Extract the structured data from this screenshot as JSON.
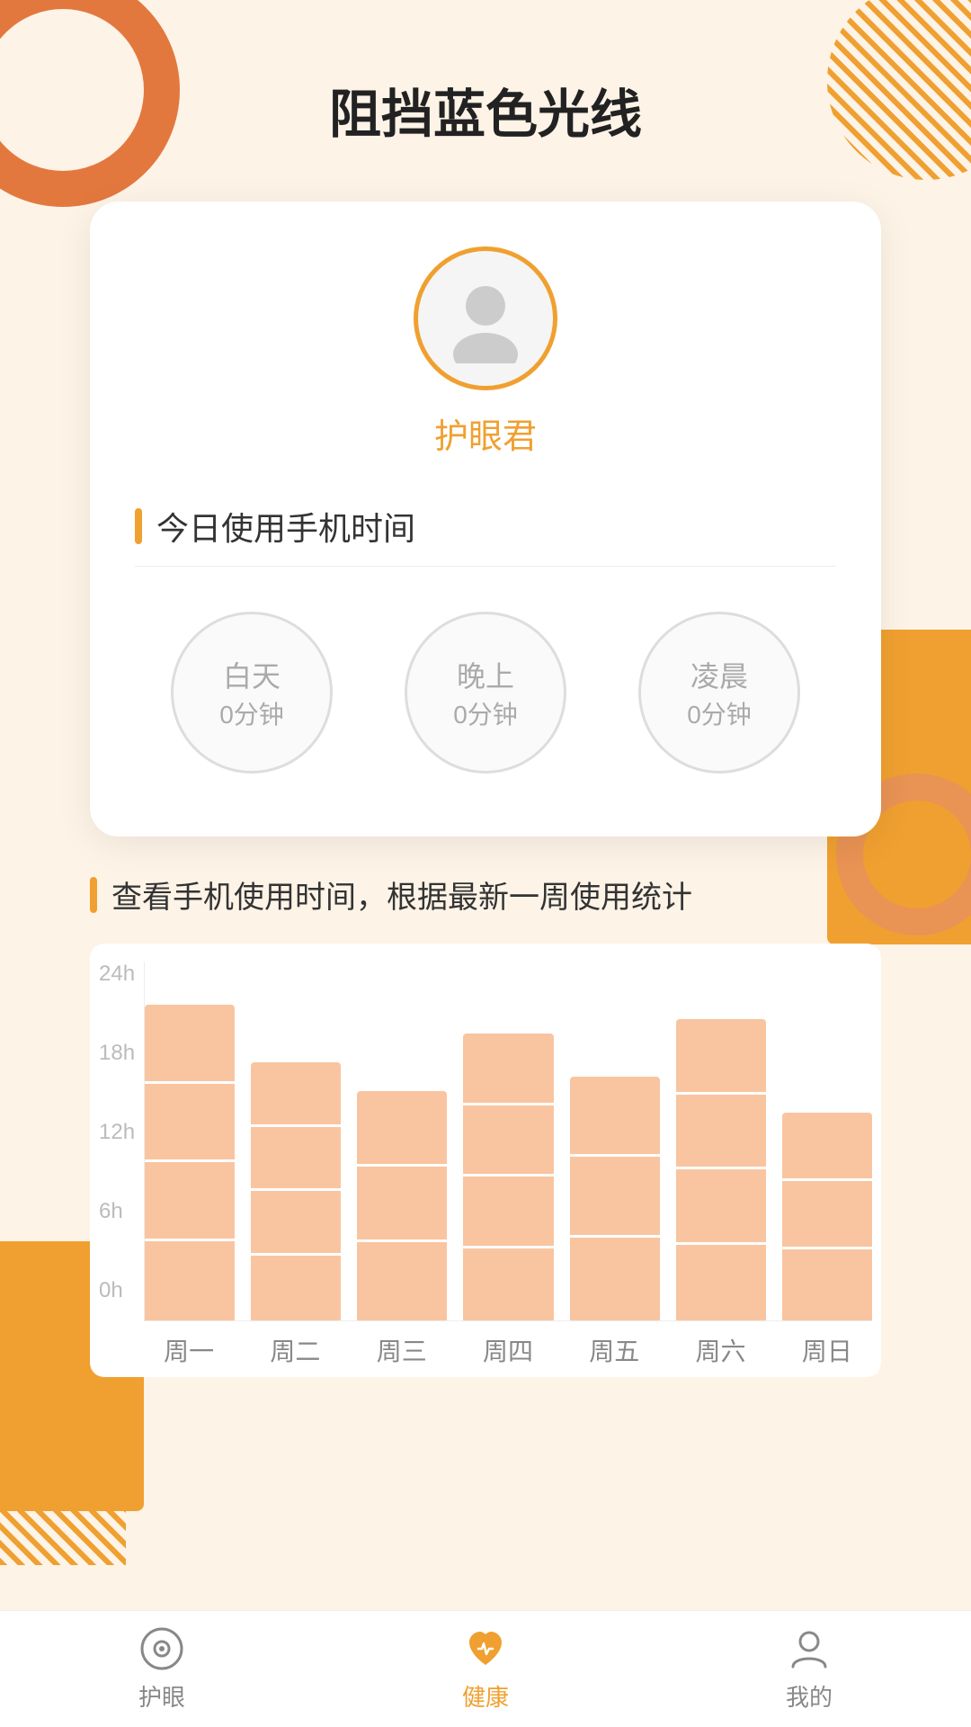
{
  "page": {
    "title": "阻挡蓝色光线",
    "background_color": "#fdf3e7"
  },
  "profile": {
    "username": "护眼君"
  },
  "usage_section": {
    "title": "今日使用手机时间",
    "daytime": {
      "label": "白天",
      "value": "0分钟"
    },
    "evening": {
      "label": "晚上",
      "value": "0分钟"
    },
    "midnight": {
      "label": "凌晨",
      "value": "0分钟"
    }
  },
  "stats_section": {
    "title": "查看手机使用时间，根据最新一周使用统计",
    "y_labels": [
      "24h",
      "18h",
      "12h",
      "6h",
      "0h"
    ],
    "x_labels": [
      "周一",
      "周二",
      "周三",
      "周四",
      "周五",
      "周六",
      "周日"
    ],
    "bars": [
      {
        "day": "周一",
        "height_pct": 88
      },
      {
        "day": "周二",
        "height_pct": 72
      },
      {
        "day": "周三",
        "height_pct": 64
      },
      {
        "day": "周四",
        "height_pct": 80
      },
      {
        "day": "周五",
        "height_pct": 68
      },
      {
        "day": "周六",
        "height_pct": 84
      },
      {
        "day": "周日",
        "height_pct": 58
      }
    ]
  },
  "bottom_nav": {
    "items": [
      {
        "id": "eye",
        "label": "护眼",
        "active": false
      },
      {
        "id": "health",
        "label": "健康",
        "active": true
      },
      {
        "id": "mine",
        "label": "我的",
        "active": false
      }
    ]
  }
}
